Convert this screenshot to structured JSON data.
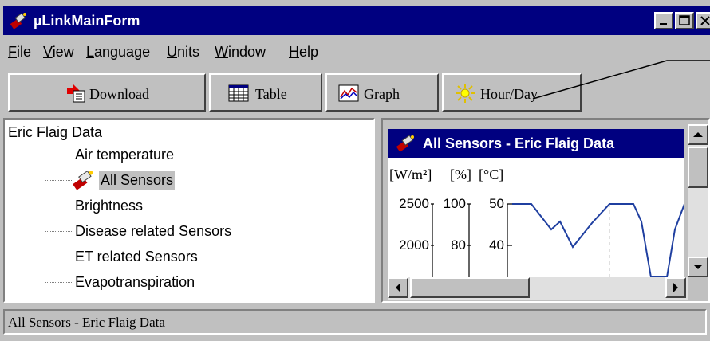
{
  "window": {
    "title": "µLinkMainForm"
  },
  "menu": [
    {
      "label": "File",
      "accel": "F",
      "rest": "ile"
    },
    {
      "label": "View",
      "accel": "V",
      "rest": "iew"
    },
    {
      "label": "Language",
      "accel": "L",
      "rest": "anguage"
    },
    {
      "label": "Units",
      "accel": "U",
      "rest": "nits"
    },
    {
      "label": "Window",
      "accel": "W",
      "rest": "indow"
    },
    {
      "label": "Help",
      "accel": "H",
      "rest": "elp"
    }
  ],
  "toolbar": {
    "download": {
      "accel": "D",
      "rest": "ownload",
      "icon": "download-icon"
    },
    "table": {
      "accel": "T",
      "rest": "able",
      "icon": "table-icon"
    },
    "graph": {
      "accel": "G",
      "rest": "raph",
      "icon": "graph-icon"
    },
    "hourday": {
      "accel": "H",
      "rest": "our/Day",
      "icon": "sun-icon"
    }
  },
  "tree": {
    "root": "Eric Flaig Data",
    "items": [
      "Air temperature",
      "All Sensors",
      "Brightness",
      "Disease related Sensors",
      "ET related Sensors",
      "Evapotranspiration"
    ],
    "selected_index": 1
  },
  "child_window": {
    "title": "All Sensors - Eric Flaig Data",
    "units": [
      "[W/m²]",
      "[%]",
      "[°C]"
    ],
    "ticks": {
      "w_m2": [
        "2500",
        "2000"
      ],
      "percent": [
        "100",
        "80"
      ],
      "celsius": [
        "50",
        "40"
      ]
    }
  },
  "status": {
    "text": "All Sensors - Eric Flaig Data"
  },
  "colors": {
    "title_bar": "#000080",
    "face": "#c0c0c0",
    "line_series": "#1f3fa0",
    "selection": "#c0c0c0"
  }
}
